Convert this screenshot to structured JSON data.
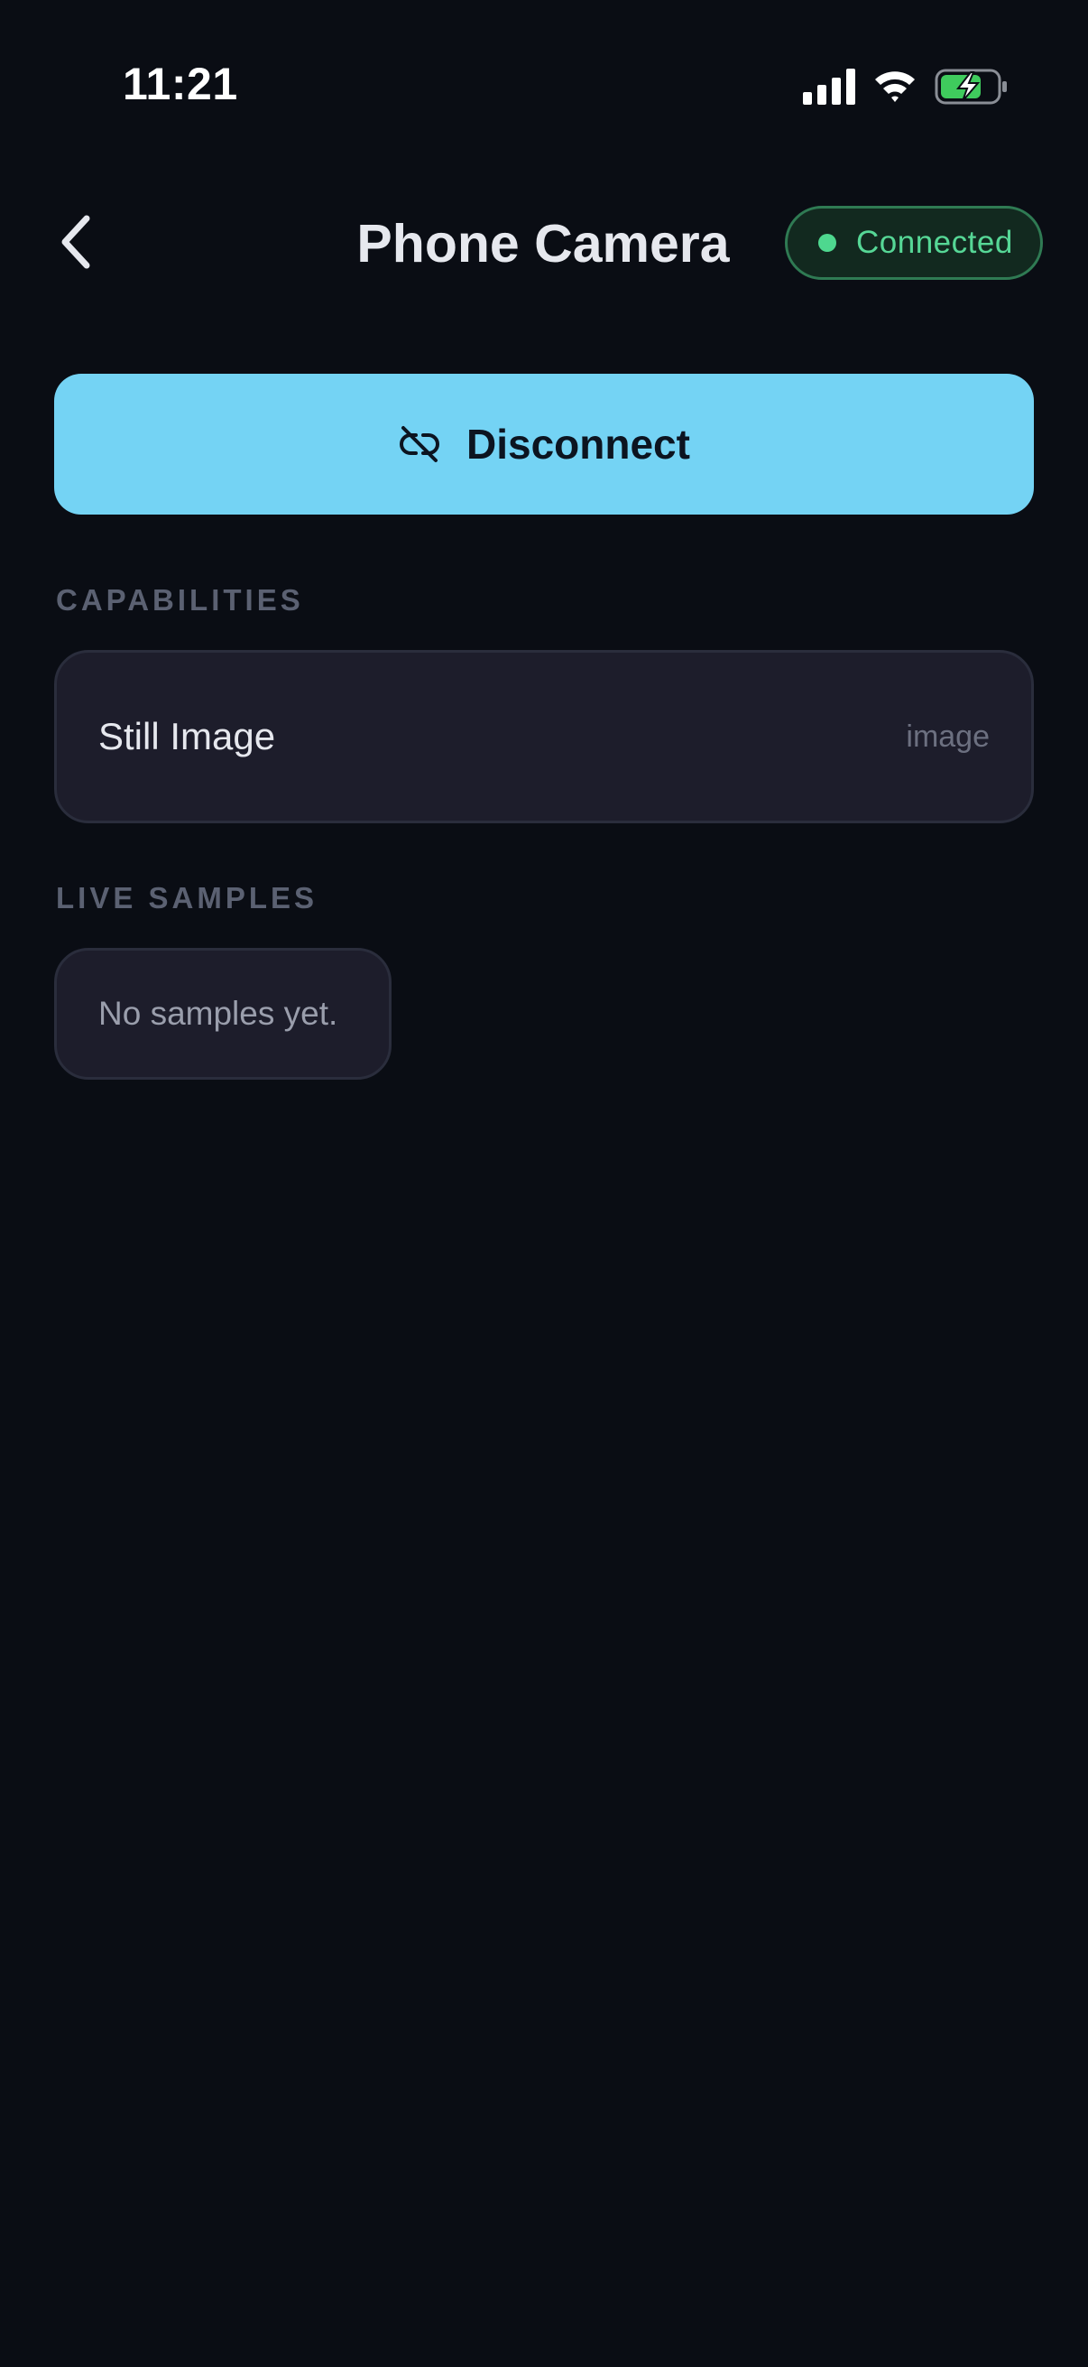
{
  "status_bar": {
    "time": "11:21",
    "icons": [
      "signal-icon",
      "wifi-icon",
      "battery-charging-icon"
    ]
  },
  "header": {
    "back_icon": "chevron-left-icon",
    "title": "Phone Camera",
    "status_badge": {
      "label": "Connected",
      "color": "#56d796"
    }
  },
  "primary_action": {
    "icon": "unlink-icon",
    "label": "Disconnect",
    "color": "#74d3f4"
  },
  "capabilities": {
    "heading": "CAPABILITIES",
    "items": [
      {
        "name": "Still Image",
        "type": "image"
      }
    ]
  },
  "live_samples": {
    "heading": "LIVE SAMPLES",
    "empty_text": "No samples yet."
  },
  "colors": {
    "background": "#0a0d14",
    "card": "#1d1d2b",
    "accent": "#74d3f4",
    "success": "#56d796"
  }
}
